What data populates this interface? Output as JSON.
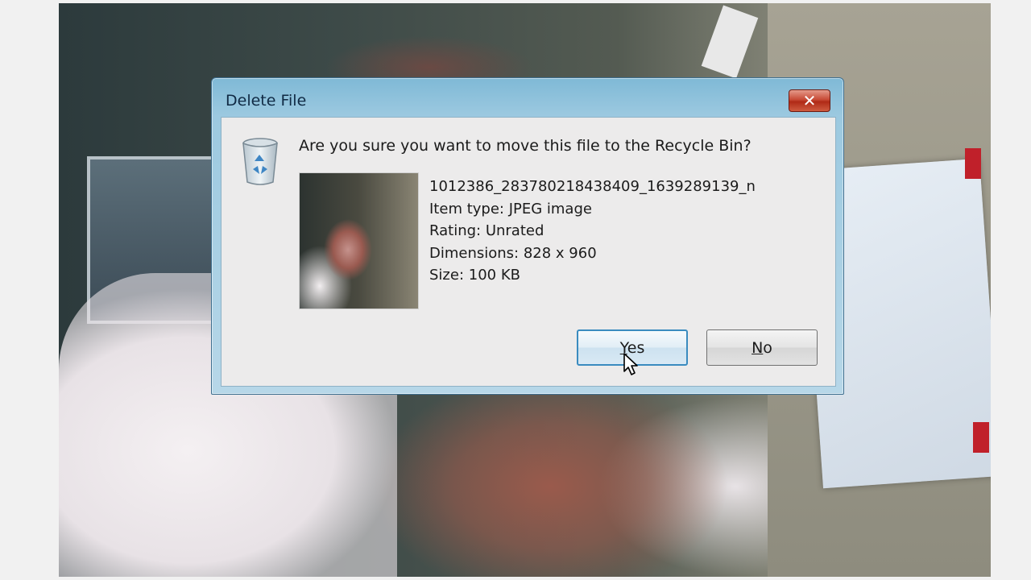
{
  "dialog": {
    "title": "Delete File",
    "close_icon": "close-icon",
    "question": "Are you sure you want to move this file to the Recycle Bin?",
    "file": {
      "name": "1012386_283780218438409_1639289139_n",
      "type": "Item type: JPEG image",
      "rating": "Rating: Unrated",
      "dimensions": "Dimensions: 828 x 960",
      "size": "Size: 100 KB"
    },
    "buttons": {
      "yes_mnemonic": "Y",
      "yes_rest": "es",
      "no_mnemonic": "N",
      "no_rest": "o"
    }
  },
  "colors": {
    "title_bar": "#9cc9e0",
    "close_button": "#c74a35",
    "focused_button_border": "#3a8bbf"
  }
}
